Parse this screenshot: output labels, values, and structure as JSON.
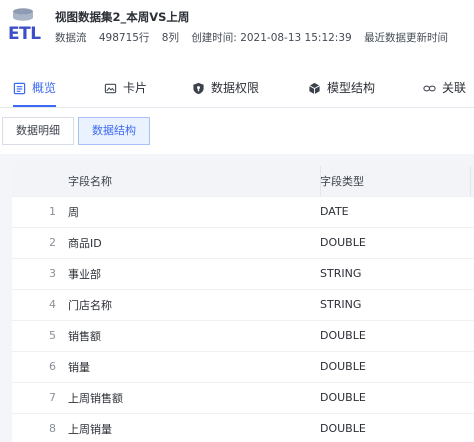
{
  "header": {
    "logo_text": "ETL",
    "title": "视图数据集2_本周VS上周",
    "meta": {
      "type": "数据流",
      "rows": "498715行",
      "cols": "8列",
      "created": "创建时间: 2021-08-13 15:12:39",
      "updated": "最近数据更新时间"
    }
  },
  "tabs": [
    {
      "label": "概览",
      "icon": "document-icon"
    },
    {
      "label": "卡片",
      "icon": "image-card-icon"
    },
    {
      "label": "数据权限",
      "icon": "shield-icon"
    },
    {
      "label": "模型结构",
      "icon": "cube-icon"
    },
    {
      "label": "关联",
      "icon": "link-icon"
    }
  ],
  "subtabs": [
    "数据明细",
    "数据结构"
  ],
  "table": {
    "headers": {
      "index": "",
      "name": "字段名称",
      "type": "字段类型"
    },
    "rows": [
      {
        "index": "1",
        "name": "周",
        "type": "DATE"
      },
      {
        "index": "2",
        "name": "商品ID",
        "type": "DOUBLE"
      },
      {
        "index": "3",
        "name": "事业部",
        "type": "STRING"
      },
      {
        "index": "4",
        "name": "门店名称",
        "type": "STRING"
      },
      {
        "index": "5",
        "name": "销售额",
        "type": "DOUBLE"
      },
      {
        "index": "6",
        "name": "销量",
        "type": "DOUBLE"
      },
      {
        "index": "7",
        "name": "上周销售额",
        "type": "DOUBLE"
      },
      {
        "index": "8",
        "name": "上周销量",
        "type": "DOUBLE"
      }
    ]
  },
  "colors": {
    "accent": "#3d6af2",
    "logo": "#3d4fc7"
  }
}
